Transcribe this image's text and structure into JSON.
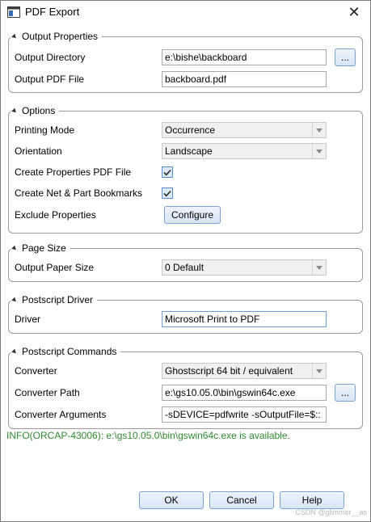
{
  "window": {
    "title": "PDF Export",
    "close_glyph": "✕"
  },
  "output_properties": {
    "legend": "Output Properties",
    "directory_label": "Output Directory",
    "directory_value": "e:\\bishe\\backboard",
    "browse_label": "...",
    "file_label": "Output PDF File",
    "file_value": "backboard.pdf"
  },
  "options": {
    "legend": "Options",
    "printing_mode_label": "Printing Mode",
    "printing_mode_value": "Occurrence",
    "orientation_label": "Orientation",
    "orientation_value": "Landscape",
    "create_props_label": "Create Properties PDF File",
    "create_props_checked": true,
    "bookmarks_label": "Create Net & Part Bookmarks",
    "bookmarks_checked": true,
    "exclude_label": "Exclude Properties",
    "configure_label": "Configure"
  },
  "page_size": {
    "legend": "Page Size",
    "paper_label": "Output Paper Size",
    "paper_value": "0 Default"
  },
  "postscript_driver": {
    "legend": "Postscript Driver",
    "driver_label": "Driver",
    "driver_value": "Microsoft Print to PDF"
  },
  "postscript_commands": {
    "legend": "Postscript Commands",
    "converter_label": "Converter",
    "converter_value": "Ghostscript 64 bit / equivalent",
    "path_label": "Converter Path",
    "path_value": "e:\\gs10.05.0\\bin\\gswin64c.exe",
    "path_browse_label": "...",
    "args_label": "Converter Arguments",
    "args_value": "-sDEVICE=pdfwrite -sOutputFile=$::"
  },
  "info_text": "INFO(ORCAP-43006): e:\\gs10.05.0\\bin\\gswin64c.exe is available.",
  "buttons": {
    "ok": "OK",
    "cancel": "Cancel",
    "help": "Help"
  },
  "watermark": "CSDN @glimmer__as",
  "colors": {
    "accent": "#5a8ed0",
    "info": "#2e8b2e",
    "border": "#9b9b9b"
  }
}
